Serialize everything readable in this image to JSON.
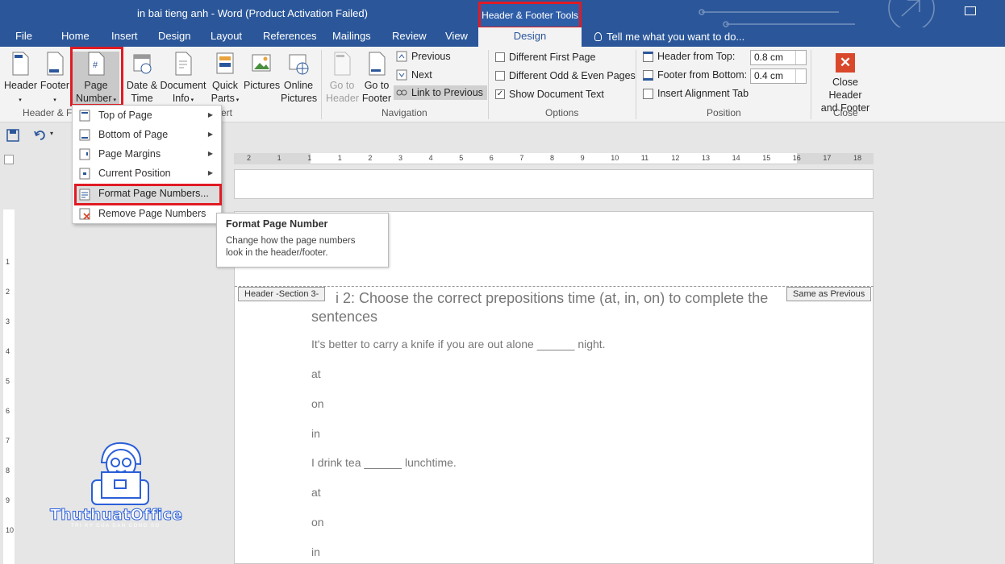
{
  "window": {
    "title": "in bai tieng anh - Word (Product Activation Failed)",
    "contextual_tools": "Header & Footer Tools"
  },
  "tabs": [
    {
      "label": "File"
    },
    {
      "label": "Home"
    },
    {
      "label": "Insert"
    },
    {
      "label": "Design"
    },
    {
      "label": "Layout"
    },
    {
      "label": "References"
    },
    {
      "label": "Mailings"
    },
    {
      "label": "Review"
    },
    {
      "label": "View"
    }
  ],
  "active_tab": "Design",
  "tellme": "Tell me what you want to do...",
  "ribbon": {
    "header": "Header",
    "footer": "Footer",
    "page_number_1": "Page",
    "page_number_2": "Number",
    "date_time_1": "Date &",
    "date_time_2": "Time",
    "doc_info_1": "Document",
    "doc_info_2": "Info",
    "quick_parts_1": "Quick",
    "quick_parts_2": "Parts",
    "pictures": "Pictures",
    "online_1": "Online",
    "online_2": "Pictures",
    "goto_header_1": "Go to",
    "goto_header_2": "Header",
    "goto_footer_1": "Go to",
    "goto_footer_2": "Footer",
    "previous": "Previous",
    "next": "Next",
    "link_previous": "Link to Previous",
    "diff_first": "Different First Page",
    "diff_odd_even": "Different Odd & Even Pages",
    "show_doc_text": "Show Document Text",
    "header_from_top": "Header from Top:",
    "header_from_top_value": "0.8 cm",
    "footer_from_bottom": "Footer from Bottom:",
    "footer_from_bottom_value": "0.4 cm",
    "insert_alignment_tab": "Insert Alignment Tab",
    "close_1": "Close Header",
    "close_2": "and Footer",
    "group_hf": "Header & F",
    "group_insert_tail": "ert",
    "group_navigation": "Navigation",
    "group_options": "Options",
    "group_position": "Position",
    "group_close": "Close"
  },
  "menu": {
    "items": [
      {
        "label": "Top of Page"
      },
      {
        "label": "Bottom of Page"
      },
      {
        "label": "Page Margins"
      },
      {
        "label": "Current Position"
      },
      {
        "label": "Format Page Numbers..."
      },
      {
        "label": "Remove Page Numbers"
      }
    ]
  },
  "tooltip": {
    "title": "Format Page Number",
    "body_1": "Change how the page numbers",
    "body_2": "look in the header/footer."
  },
  "ruler": {
    "h_labels": [
      "2",
      "1",
      "1",
      "1",
      "2",
      "3",
      "4",
      "5",
      "6",
      "7",
      "8",
      "9",
      "10",
      "11",
      "12",
      "13",
      "14",
      "15",
      "16",
      "17",
      "18"
    ],
    "v_labels": [
      "1",
      "2",
      "3",
      "4",
      "5",
      "6",
      "7",
      "8",
      "9",
      "10"
    ]
  },
  "doc": {
    "header_tag": "Header -Section 3-",
    "same_prev": "Same as Previous",
    "heading_1": "i 2: Choose the correct prepositions time (at, in, on) to complete the",
    "heading_2": "sentences",
    "lines": [
      "It's better to carry a knife if you are out alone ______ night.",
      "at",
      "on",
      "in",
      "I drink tea ______ lunchtime.",
      "at",
      "on",
      "in"
    ]
  },
  "logo": {
    "text": "ThuthuatOffice",
    "sub": "TRI KY CUA DAN CONG SO"
  }
}
